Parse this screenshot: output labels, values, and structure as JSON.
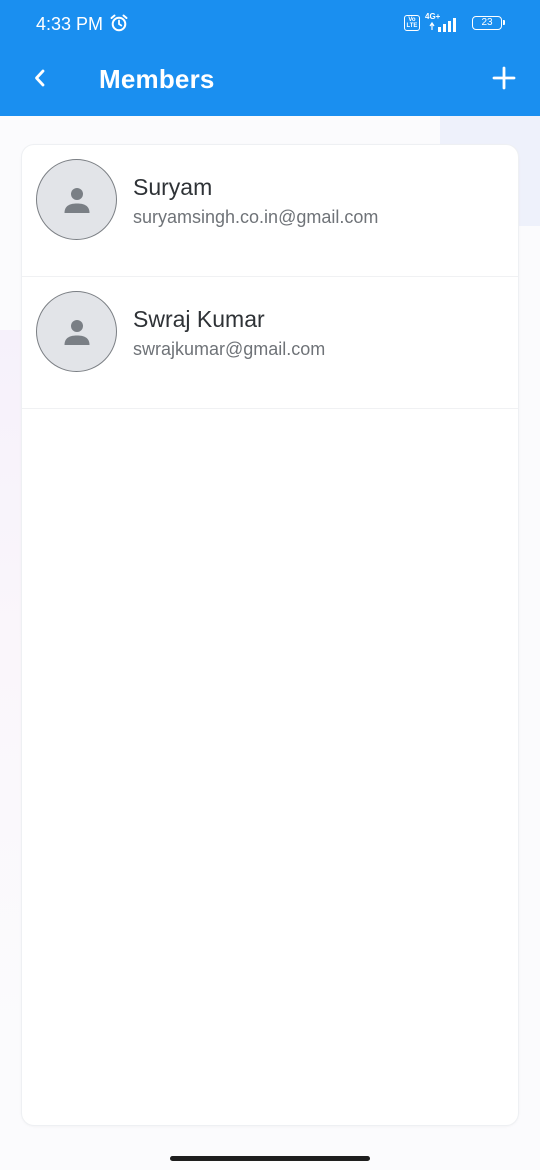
{
  "status_bar": {
    "time": "4:33 PM",
    "network": "4G+",
    "volte": "Vo LTE",
    "battery": "23",
    "icons": [
      "alarm-icon",
      "volte-icon",
      "signal-icon",
      "battery-icon"
    ]
  },
  "app_bar": {
    "title": "Members",
    "back_icon": "chevron-left-icon",
    "add_icon": "plus-icon",
    "background_color": "#1a8ff0"
  },
  "members": [
    {
      "name": "Suryam",
      "email": "suryamsingh.co.in@gmail.com",
      "avatar_icon": "person-icon"
    },
    {
      "name": "Swraj Kumar",
      "email": "swrajkumar@gmail.com",
      "avatar_icon": "person-icon"
    }
  ]
}
